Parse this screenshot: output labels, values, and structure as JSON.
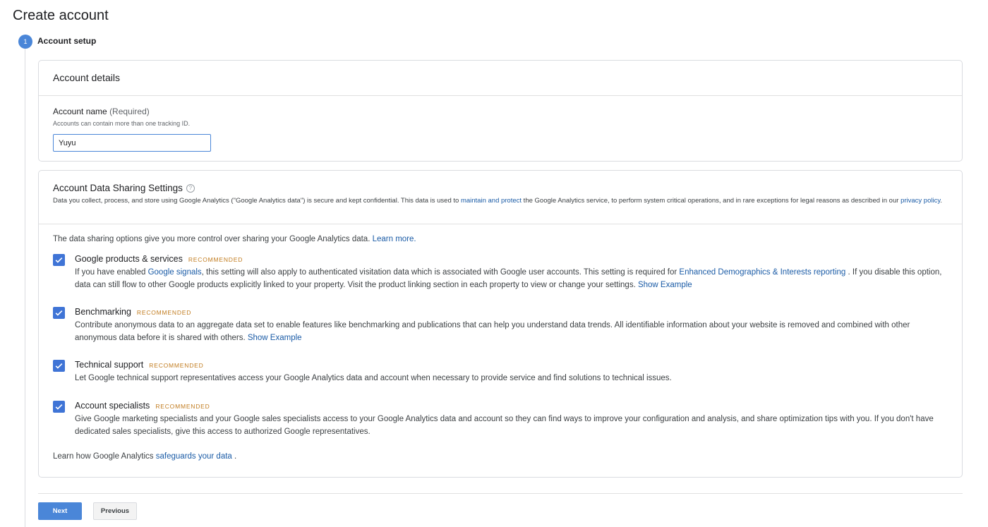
{
  "page": {
    "title": "Create account"
  },
  "step": {
    "number": "1",
    "label": "Account setup"
  },
  "details": {
    "heading": "Account details",
    "field_label": "Account name",
    "field_required": "(Required)",
    "field_help": "Accounts can contain more than one tracking ID.",
    "field_value": "Yuyu"
  },
  "sharing": {
    "heading": "Account Data Sharing Settings",
    "help_glyph": "?",
    "desc_part1": "Data you collect, process, and store using Google Analytics (\"Google Analytics data\") is secure and kept confidential. This data is used to ",
    "desc_link1": "maintain and protect",
    "desc_part2": " the Google Analytics service, to perform system critical operations, and in rare exceptions for legal reasons as described in our ",
    "desc_link2": "privacy policy",
    "desc_part3": ".",
    "intro_text": "The data sharing options give you more control over sharing your Google Analytics data. ",
    "intro_link": "Learn more.",
    "options": [
      {
        "title": "Google products & services",
        "badge": "RECOMMENDED",
        "text1": "If you have enabled ",
        "link1": "Google signals",
        "text2": ", this setting will also apply to authenticated visitation data which is associated with Google user accounts. This setting is required for ",
        "link2": "Enhanced Demographics & Interests reporting",
        "text3": " . If you disable this option, data can still flow to other Google products explicitly linked to your property. Visit the product linking section in each property to view or change your settings. ",
        "link3": "Show Example",
        "checked": true
      },
      {
        "title": "Benchmarking",
        "badge": "RECOMMENDED",
        "text1": "Contribute anonymous data to an aggregate data set to enable features like benchmarking and publications that can help you understand data trends. All identifiable information about your website is removed and combined with other anonymous data before it is shared with others. ",
        "link1": "Show Example",
        "checked": true
      },
      {
        "title": "Technical support",
        "badge": "RECOMMENDED",
        "text1": "Let Google technical support representatives access your Google Analytics data and account when necessary to provide service and find solutions to technical issues.",
        "checked": true
      },
      {
        "title": "Account specialists",
        "badge": "RECOMMENDED",
        "text1": "Give Google marketing specialists and your Google sales specialists access to your Google Analytics data and account so they can find ways to improve your configuration and analysis, and share optimization tips with you. If you don't have dedicated sales specialists, give this access to authorized Google representatives.",
        "checked": true
      }
    ],
    "footer_text": "Learn how Google Analytics ",
    "footer_link": "safeguards your data",
    "footer_end": " ."
  },
  "buttons": {
    "next": "Next",
    "previous": "Previous"
  },
  "colors": {
    "accent": "#4a86d8",
    "checkbox": "#3f74d6",
    "link": "#1a5ba6",
    "badge": "#c17b1e"
  }
}
